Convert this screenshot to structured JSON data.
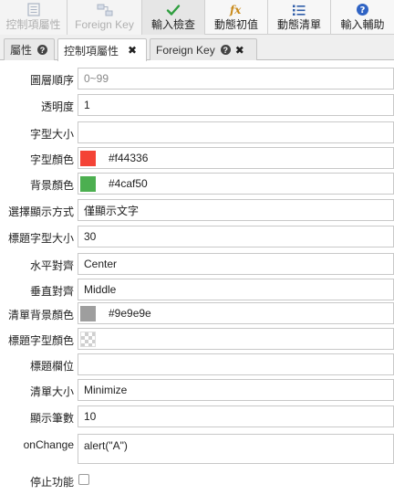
{
  "toolbar": {
    "buttons": [
      {
        "label": "控制項屬性",
        "icon": "list-doc-icon",
        "state": "disabled"
      },
      {
        "label": "Foreign Key",
        "icon": "foreign-key-icon",
        "state": "disabled"
      },
      {
        "label": "輸入檢查",
        "icon": "checkmark-icon",
        "state": "active"
      },
      {
        "label": "動態初值",
        "icon": "function-icon",
        "state": "normal"
      },
      {
        "label": "動態清單",
        "icon": "bullet-list-icon",
        "state": "normal"
      },
      {
        "label": "輸入輔助",
        "icon": "help-circle-icon",
        "state": "normal"
      }
    ]
  },
  "tabs": [
    {
      "label": "屬性",
      "has_help": true,
      "closable": false
    },
    {
      "label": "控制項屬性",
      "has_help": false,
      "closable": true,
      "active": true
    },
    {
      "label": "Foreign Key",
      "has_help": true,
      "closable": true
    }
  ],
  "properties": {
    "layer_order": {
      "label": "圖層順序",
      "value": "",
      "placeholder": "0~99"
    },
    "opacity": {
      "label": "透明度",
      "value": "1"
    },
    "font_size": {
      "label": "字型大小",
      "value": ""
    },
    "font_color": {
      "label": "字型顏色",
      "value": "#f44336",
      "color": "#f44336"
    },
    "bg_color": {
      "label": "背景顏色",
      "value": "#4caf50",
      "color": "#4caf50"
    },
    "display_mode": {
      "label": "選擇顯示方式",
      "value": "僅顯示文字"
    },
    "title_font_size": {
      "label": "標題字型大小",
      "value": "30"
    },
    "h_align": {
      "label": "水平對齊",
      "value": "Center"
    },
    "v_align": {
      "label": "垂直對齊",
      "value": "Middle"
    },
    "list_bg_color": {
      "label": "清單背景顏色",
      "value": "#9e9e9e",
      "color": "#9e9e9e"
    },
    "title_font_color": {
      "label": "標題字型顏色",
      "value": "",
      "transparent": true
    },
    "title_field": {
      "label": "標題欄位",
      "value": ""
    },
    "list_size": {
      "label": "清單大小",
      "value": "Minimize"
    },
    "display_count": {
      "label": "顯示筆數",
      "value": "10"
    },
    "on_change": {
      "label": "onChange",
      "value": "alert(\"A\")"
    },
    "disabled": {
      "label": "停止功能",
      "checked": false
    }
  }
}
